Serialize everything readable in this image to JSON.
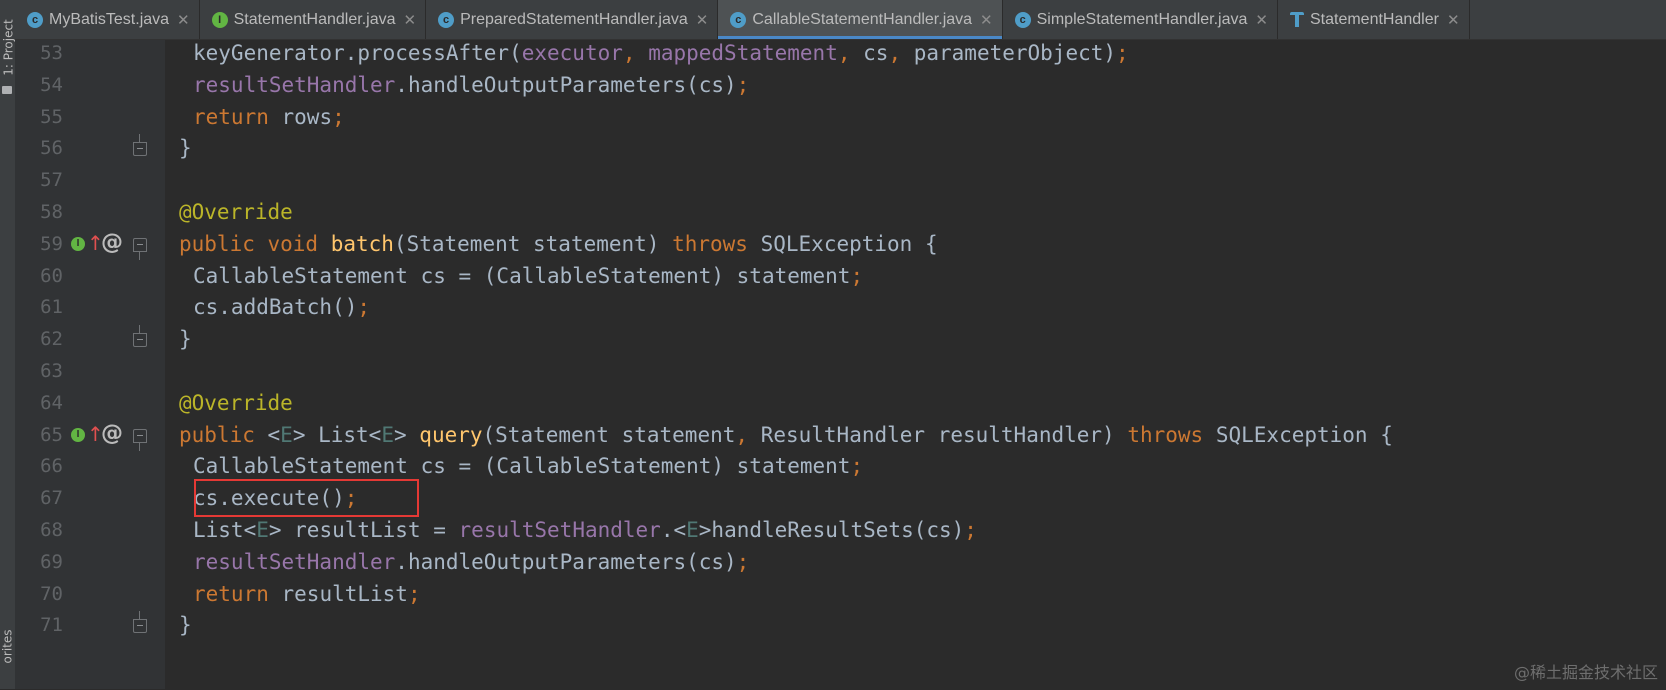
{
  "sidebar": {
    "project_label": "1: Project",
    "favorites_label": "orites"
  },
  "tabs": [
    {
      "label": "MyBatisTest.java",
      "icon": "class-icon",
      "active": false,
      "closable": true
    },
    {
      "label": "StatementHandler.java",
      "icon": "interface-icon",
      "active": false,
      "closable": true
    },
    {
      "label": "PreparedStatementHandler.java",
      "icon": "class-icon",
      "active": false,
      "closable": true
    },
    {
      "label": "CallableStatementHandler.java",
      "icon": "class-icon",
      "active": true,
      "closable": true
    },
    {
      "label": "SimpleStatementHandler.java",
      "icon": "class-icon",
      "active": false,
      "closable": true
    },
    {
      "label": "StatementHandler",
      "icon": "structure-icon",
      "active": false,
      "closable": true
    }
  ],
  "close_glyph": "✕",
  "gutter_icons": {
    "implements": "I",
    "up_arrow": "↑",
    "at": "@"
  },
  "lines": [
    {
      "num": "53",
      "indent": 2,
      "tokens": [
        {
          "t": "keyGenerator.processAfter(",
          "c": ""
        },
        {
          "t": "executor",
          "c": "fld"
        },
        {
          "t": ", ",
          "c": "pun"
        },
        {
          "t": "mappedStatement",
          "c": "fld"
        },
        {
          "t": ", ",
          "c": "pun"
        },
        {
          "t": "cs",
          "c": ""
        },
        {
          "t": ", ",
          "c": "pun"
        },
        {
          "t": "parameterObject)",
          "c": ""
        },
        {
          "t": ";",
          "c": "pun"
        }
      ]
    },
    {
      "num": "54",
      "indent": 2,
      "tokens": [
        {
          "t": "resultSetHandler",
          "c": "fld"
        },
        {
          "t": ".handleOutputParameters(cs)",
          "c": ""
        },
        {
          "t": ";",
          "c": "pun"
        }
      ]
    },
    {
      "num": "55",
      "indent": 2,
      "tokens": [
        {
          "t": "return ",
          "c": "kw"
        },
        {
          "t": "rows",
          "c": ""
        },
        {
          "t": ";",
          "c": "pun"
        }
      ]
    },
    {
      "num": "56",
      "indent": 1,
      "fold": "close",
      "tokens": [
        {
          "t": "}",
          "c": ""
        }
      ]
    },
    {
      "num": "57",
      "indent": 0,
      "tokens": []
    },
    {
      "num": "58",
      "indent": 1,
      "tokens": [
        {
          "t": "@Override",
          "c": "ann"
        }
      ]
    },
    {
      "num": "59",
      "indent": 1,
      "fold": "open",
      "marker": true,
      "tokens": [
        {
          "t": "public void ",
          "c": "kw"
        },
        {
          "t": "batch",
          "c": "mth"
        },
        {
          "t": "(Statement statement) ",
          "c": ""
        },
        {
          "t": "throws ",
          "c": "kw"
        },
        {
          "t": "SQLException {",
          "c": ""
        }
      ]
    },
    {
      "num": "60",
      "indent": 2,
      "tokens": [
        {
          "t": "CallableStatement cs = (CallableStatement) statement",
          "c": ""
        },
        {
          "t": ";",
          "c": "pun"
        }
      ]
    },
    {
      "num": "61",
      "indent": 2,
      "tokens": [
        {
          "t": "cs.addBatch()",
          "c": ""
        },
        {
          "t": ";",
          "c": "pun"
        }
      ]
    },
    {
      "num": "62",
      "indent": 1,
      "fold": "close",
      "tokens": [
        {
          "t": "}",
          "c": ""
        }
      ]
    },
    {
      "num": "63",
      "indent": 0,
      "tokens": []
    },
    {
      "num": "64",
      "indent": 1,
      "tokens": [
        {
          "t": "@Override",
          "c": "ann"
        }
      ]
    },
    {
      "num": "65",
      "indent": 1,
      "fold": "open",
      "marker": true,
      "tokens": [
        {
          "t": "public ",
          "c": "kw"
        },
        {
          "t": "<",
          "c": ""
        },
        {
          "t": "E",
          "c": "gen"
        },
        {
          "t": "> List<",
          "c": ""
        },
        {
          "t": "E",
          "c": "gen"
        },
        {
          "t": "> ",
          "c": ""
        },
        {
          "t": "query",
          "c": "mth"
        },
        {
          "t": "(Statement statement",
          "c": ""
        },
        {
          "t": ", ",
          "c": "pun"
        },
        {
          "t": "ResultHandler resultHandler) ",
          "c": ""
        },
        {
          "t": "throws ",
          "c": "kw"
        },
        {
          "t": "SQLException {",
          "c": ""
        }
      ]
    },
    {
      "num": "66",
      "indent": 2,
      "tokens": [
        {
          "t": "CallableStatement cs = (CallableStatement) statement",
          "c": ""
        },
        {
          "t": ";",
          "c": "pun"
        }
      ]
    },
    {
      "num": "67",
      "indent": 2,
      "tokens": [
        {
          "t": "cs.execute()",
          "c": ""
        },
        {
          "t": ";",
          "c": "pun"
        }
      ]
    },
    {
      "num": "68",
      "indent": 2,
      "tokens": [
        {
          "t": "List<",
          "c": ""
        },
        {
          "t": "E",
          "c": "gen"
        },
        {
          "t": "> resultList = ",
          "c": ""
        },
        {
          "t": "resultSetHandler",
          "c": "fld"
        },
        {
          "t": ".<",
          "c": ""
        },
        {
          "t": "E",
          "c": "gen"
        },
        {
          "t": ">handleResultSets(cs)",
          "c": ""
        },
        {
          "t": ";",
          "c": "pun"
        }
      ]
    },
    {
      "num": "69",
      "indent": 2,
      "tokens": [
        {
          "t": "resultSetHandler",
          "c": "fld"
        },
        {
          "t": ".handleOutputParameters(cs)",
          "c": ""
        },
        {
          "t": ";",
          "c": "pun"
        }
      ]
    },
    {
      "num": "70",
      "indent": 2,
      "tokens": [
        {
          "t": "return ",
          "c": "kw"
        },
        {
          "t": "resultList",
          "c": ""
        },
        {
          "t": ";",
          "c": "pun"
        }
      ]
    },
    {
      "num": "71",
      "indent": 1,
      "fold": "close",
      "tokens": [
        {
          "t": "}",
          "c": ""
        }
      ]
    }
  ],
  "highlighted_line": "67",
  "watermark": "@稀土掘金技术社区",
  "colors": {
    "keyword": "#cc7832",
    "field": "#9876aa",
    "annotation": "#bbb529",
    "method": "#ffc66d",
    "generic": "#507874",
    "text": "#a9b7c6",
    "highlight_box": "#e53935",
    "active_tab_underline": "#4a88c7"
  }
}
